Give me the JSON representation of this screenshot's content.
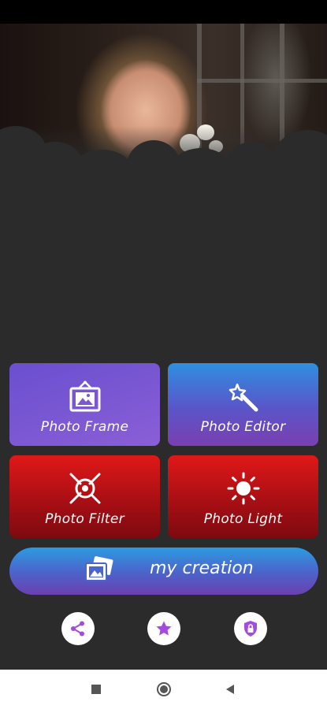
{
  "hero": {
    "image": "woman-portrait-photo"
  },
  "tiles": {
    "frame": {
      "label": "Photo Frame",
      "icon": "picture-frame-icon"
    },
    "editor": {
      "label": "Photo Editor",
      "icon": "magic-wand-icon"
    },
    "filter": {
      "label": "Photo Filter",
      "icon": "aperture-filter-icon"
    },
    "light": {
      "label": "Photo Light",
      "icon": "sun-light-icon"
    }
  },
  "creation": {
    "label": "my creation",
    "icon": "photo-stack-icon"
  },
  "actions": [
    {
      "name": "share",
      "icon": "share-icon"
    },
    {
      "name": "rate",
      "icon": "star-icon"
    },
    {
      "name": "privacy",
      "icon": "shield-lock-icon"
    }
  ],
  "colors": {
    "accent_purple": "#a54ae0",
    "frame_tile": "#7a58d3",
    "red_tile": "#c8141a",
    "blue_gradient": "#2d9be0"
  },
  "navigation": {
    "buttons": [
      "recents-icon",
      "home-icon",
      "back-icon"
    ]
  }
}
